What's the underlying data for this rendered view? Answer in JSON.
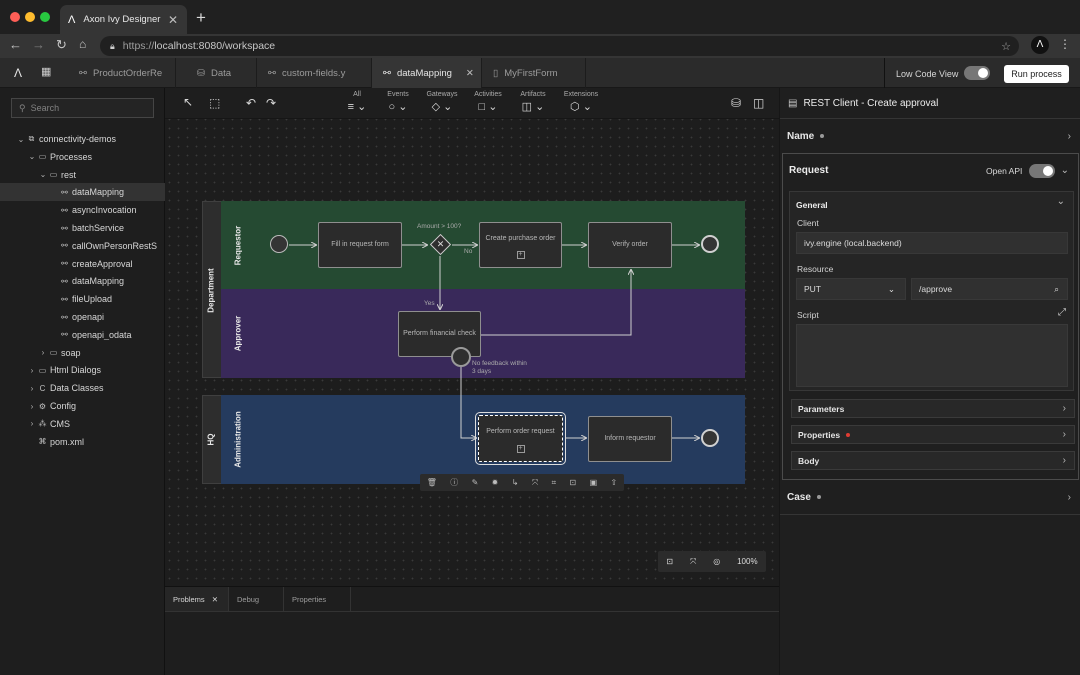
{
  "browser": {
    "tab_title": "Axon Ivy Designer",
    "tab_close": "✕",
    "new_tab": "+",
    "url_host": "localhost:8080/workspace",
    "url_scheme": "https://"
  },
  "app": {
    "logo": "Λ",
    "tabs": [
      {
        "label": "ProductOrderRe",
        "icon": "process-icon"
      },
      {
        "label": "Data",
        "icon": "data-class-icon"
      },
      {
        "label": "custom-fields.y",
        "icon": "process-icon"
      },
      {
        "label": "dataMapping",
        "icon": "process-icon"
      },
      {
        "label": "MyFirstForm",
        "icon": "form-icon"
      }
    ],
    "low_code_label": "Low Code View",
    "run_label": "Run process"
  },
  "sidebar": {
    "search_placeholder": "Search",
    "items": [
      {
        "label": "connectivity-demos",
        "level": 0,
        "twisty": "v",
        "icon": "project-icon",
        "selected": false
      },
      {
        "label": "Processes",
        "level": 1,
        "twisty": "v",
        "icon": "folder-icon",
        "selected": false
      },
      {
        "label": "rest",
        "level": 2,
        "twisty": "v",
        "icon": "folder-icon",
        "selected": false
      },
      {
        "label": "dataMapping",
        "level": 3,
        "twisty": "",
        "icon": "process-icon",
        "selected": true
      },
      {
        "label": "asyncInvocation",
        "level": 3,
        "twisty": "",
        "icon": "process-icon",
        "selected": false
      },
      {
        "label": "batchService",
        "level": 3,
        "twisty": "",
        "icon": "process-icon",
        "selected": false
      },
      {
        "label": "callOwnPersonRestS",
        "level": 3,
        "twisty": "",
        "icon": "process-icon",
        "selected": false
      },
      {
        "label": "createApproval",
        "level": 3,
        "twisty": "",
        "icon": "process-icon",
        "selected": false
      },
      {
        "label": "dataMapping",
        "level": 3,
        "twisty": "",
        "icon": "process-icon",
        "selected": false
      },
      {
        "label": "fileUpload",
        "level": 3,
        "twisty": "",
        "icon": "process-icon",
        "selected": false
      },
      {
        "label": "openapi",
        "level": 3,
        "twisty": "",
        "icon": "process-icon",
        "selected": false
      },
      {
        "label": "openapi_odata",
        "level": 3,
        "twisty": "",
        "icon": "process-icon",
        "selected": false
      },
      {
        "label": "soap",
        "level": 2,
        "twisty": ">",
        "icon": "folder-icon",
        "selected": false
      },
      {
        "label": "Html Dialogs",
        "level": 1,
        "twisty": ">",
        "icon": "folder-icon",
        "selected": false
      },
      {
        "label": "Data Classes",
        "level": 1,
        "twisty": ">",
        "icon": "data-class-icon",
        "selected": false
      },
      {
        "label": "Config",
        "level": 1,
        "twisty": ">",
        "icon": "config-icon",
        "selected": false
      },
      {
        "label": "CMS",
        "level": 1,
        "twisty": ">",
        "icon": "cms-icon",
        "selected": false
      },
      {
        "label": "pom.xml",
        "level": 1,
        "twisty": "",
        "icon": "file-icon",
        "selected": false
      }
    ]
  },
  "toolbar": {
    "groups": [
      {
        "label": "All",
        "icon": "≡ ⌄"
      },
      {
        "label": "Events",
        "icon": "○ ⌄"
      },
      {
        "label": "Gateways",
        "icon": "◇ ⌄"
      },
      {
        "label": "Activities",
        "icon": "□ ⌄"
      },
      {
        "label": "Artifacts",
        "icon": "◫ ⌄"
      },
      {
        "label": "Extensions",
        "icon": "⬡ ⌄"
      }
    ]
  },
  "diagram": {
    "pool_department": "Department",
    "pool_hq": "HQ",
    "lane_requestor": "Requestor",
    "lane_approver": "Approver",
    "lane_admin": "Administration",
    "task_fill": "Fill in request form",
    "gateway_label": "Amount > 100?",
    "gateway_symbol": "✕",
    "flow_no": "No",
    "flow_yes": "Yes",
    "task_create_purchase": "Create purchase order",
    "task_verify": "Verify order",
    "task_financial": "Perform financial check",
    "boundary_label": "No feedback within 3 days",
    "task_perform_order": "Perform order request",
    "task_inform": "Inform requestor",
    "sub_marker": "+"
  },
  "quickbar": {
    "icons": [
      "🗑",
      "ⓘ",
      "✎",
      "✹",
      "↳",
      "⤧",
      "⌗",
      "⊡",
      "▣",
      "⇧"
    ]
  },
  "zoom": {
    "value": "100%"
  },
  "bottom": {
    "tabs": [
      "Problems",
      "Debug",
      "Properties"
    ],
    "close": "✕"
  },
  "inspector": {
    "title": "REST Client - Create approval",
    "name_section": "Name",
    "request_section": "Request",
    "open_api_label": "Open API",
    "general_section": "General",
    "client_label": "Client",
    "client_value": "ivy.engine (local.backend)",
    "resource_label": "Resource",
    "method_value": "PUT",
    "path_value": "/approve",
    "script_label": "Script",
    "parameters_section": "Parameters",
    "properties_section": "Properties",
    "body_section": "Body",
    "case_section": "Case"
  },
  "colors": {
    "requestor_lane": "#254a32",
    "approver_lane": "#39295a",
    "admin_lane": "#253b5e",
    "required_dot": "#e03c32"
  }
}
